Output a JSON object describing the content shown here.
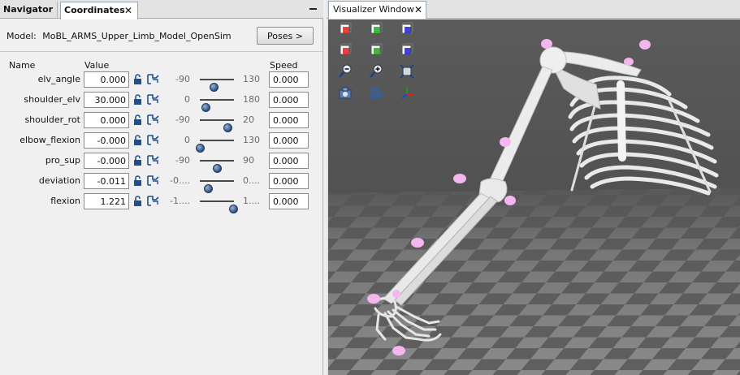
{
  "left_panel": {
    "tabs": [
      {
        "label": "Navigator"
      },
      {
        "label": "Coordinates",
        "close": "✕"
      }
    ],
    "model_prefix": "Model:",
    "model_name": "MoBL_ARMS_Upper_Limb_Model_OpenSim",
    "poses_button": "Poses >",
    "headers": {
      "name": "Name",
      "value": "Value",
      "speed": "Speed"
    },
    "coordinates": [
      {
        "name": "elv_angle",
        "value": "0.000",
        "min": "-90",
        "max": "130",
        "speed": "0.000",
        "slider_fraction": 0.41
      },
      {
        "name": "shoulder_elv",
        "value": "30.000",
        "min": "0",
        "max": "180",
        "speed": "0.000",
        "slider_fraction": 0.17
      },
      {
        "name": "shoulder_rot",
        "value": "0.000",
        "min": "-90",
        "max": "20",
        "speed": "0.000",
        "slider_fraction": 0.82
      },
      {
        "name": "elbow_flexion",
        "value": "-0.000",
        "min": "0",
        "max": "130",
        "speed": "0.000",
        "slider_fraction": 0.0
      },
      {
        "name": "pro_sup",
        "value": "-0.000",
        "min": "-90",
        "max": "90",
        "speed": "0.000",
        "slider_fraction": 0.5
      },
      {
        "name": "deviation",
        "value": "-0.011",
        "min": "-0....",
        "max": "0....",
        "speed": "0.000",
        "slider_fraction": 0.23
      },
      {
        "name": "flexion",
        "value": "1.221",
        "min": "-1....",
        "max": "1....",
        "speed": "0.000",
        "slider_fraction": 0.97
      }
    ]
  },
  "visualizer": {
    "tab_label": "Visualizer Window",
    "tab_close": "✕",
    "toolbar_icons": [
      "view-front-icon",
      "view-right-icon",
      "view-top-icon",
      "view-back-icon",
      "view-left-icon",
      "view-bottom-icon",
      "zoom-out-icon",
      "zoom-in-icon",
      "fit-view-icon",
      "snapshot-icon",
      "record-movie-icon",
      "axes-icon"
    ],
    "colors": {
      "background": "#565656",
      "floor_light": "#8c8c8c",
      "floor_dark": "#5a5a5a",
      "bone": "#eeeeee",
      "marker": "#f3b6ee"
    }
  }
}
